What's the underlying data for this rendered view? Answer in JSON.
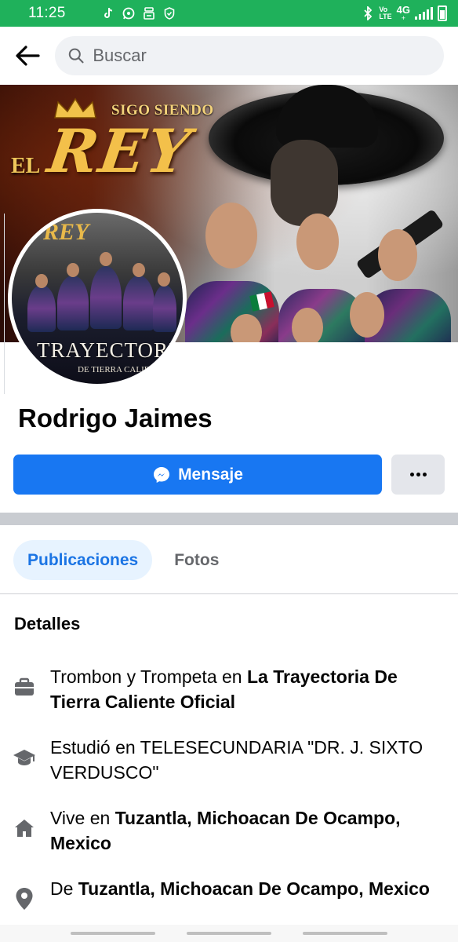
{
  "status_bar": {
    "time": "11:25",
    "network_top": "Vo",
    "network_bottom": "LTE",
    "network_type": "4G",
    "network_sub": "+",
    "battery_level": 0.7,
    "icons": [
      "tiktok-icon",
      "whatsapp-icon",
      "assistant-icon",
      "shield-icon",
      "bluetooth-icon",
      "signal-icon",
      "battery-icon"
    ]
  },
  "header": {
    "back_icon": "arrow-left-icon",
    "search_placeholder": "Buscar"
  },
  "cover": {
    "sigo_siendo": "SIGO SIENDO",
    "el": "EL",
    "rey": "REY"
  },
  "avatar": {
    "rey": "REY",
    "trayectoria": "TRAYECTORIA",
    "tierra": "DE TIERRA CALIENTE"
  },
  "profile": {
    "name": "Rodrigo Jaimes",
    "message_button": "Mensaje",
    "more_button_icon": "more-dots-icon"
  },
  "tabs": {
    "active": "Publicaciones",
    "second": "Fotos"
  },
  "details": {
    "title": "Detalles",
    "items": [
      {
        "icon": "briefcase-icon",
        "prefix": "Trombon y Trompeta en ",
        "bold": "La Trayectoria De Tierra Caliente Oficial"
      },
      {
        "icon": "graduation-cap-icon",
        "prefix": "Estudió en TELESECUNDARIA \"DR. J. SIXTO VERDUSCO\"",
        "bold": ""
      },
      {
        "icon": "home-icon",
        "prefix": "Vive en ",
        "bold": "Tuzantla, Michoacan De Ocampo, Mexico"
      },
      {
        "icon": "location-pin-icon",
        "prefix": "De ",
        "bold": "Tuzantla, Michoacan De Ocampo, Mexico"
      }
    ]
  },
  "colors": {
    "status_bar": "#1fb15b",
    "primary": "#1877f2",
    "tab_active_bg": "#e7f3ff",
    "tab_active_text": "#1b74e4"
  }
}
